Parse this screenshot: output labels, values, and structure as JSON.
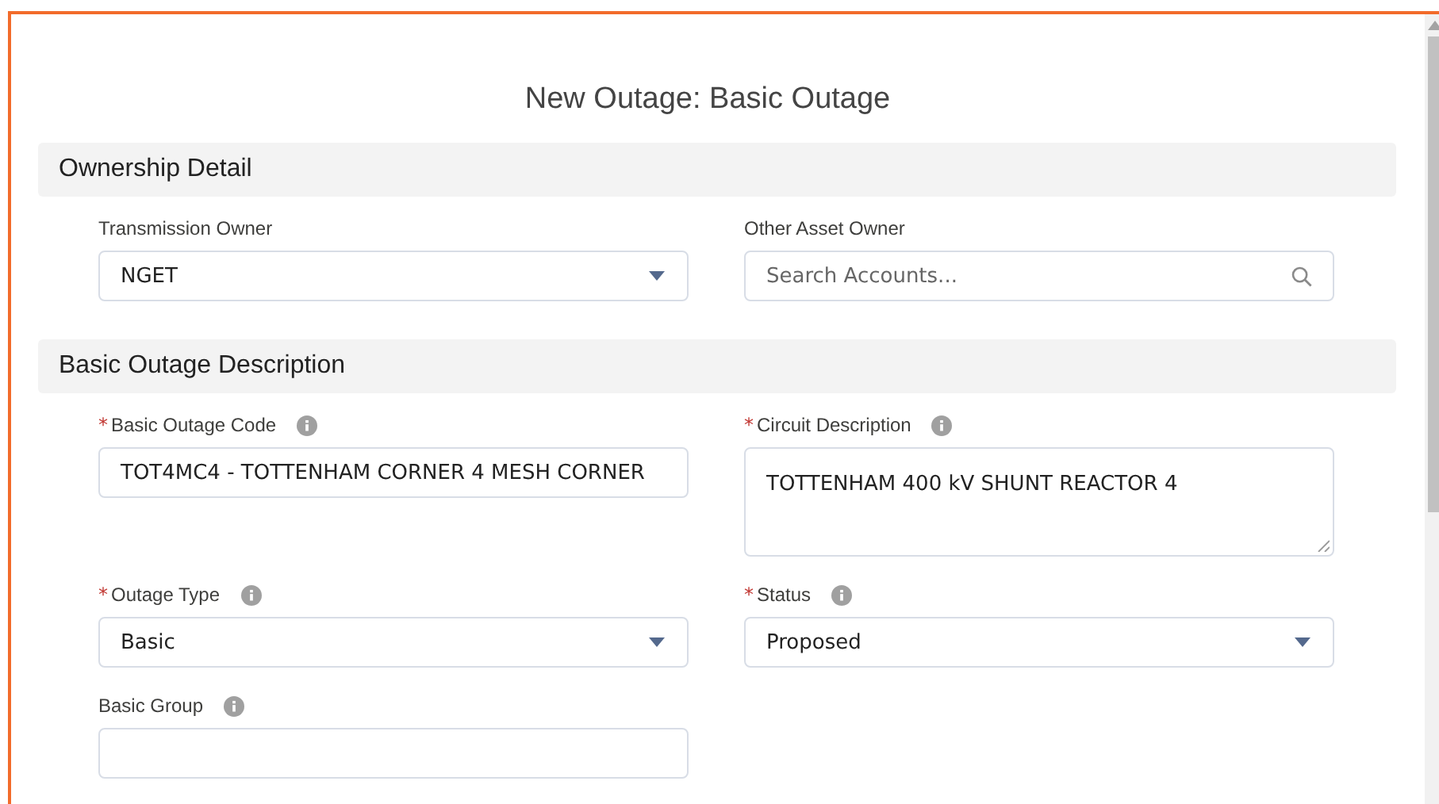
{
  "modal": {
    "title": "New Outage: Basic Outage"
  },
  "sections": [
    {
      "title": "Ownership Detail",
      "fields": [
        {
          "label": "Transmission Owner",
          "kind": "picklist",
          "value": "NGET"
        },
        {
          "label": "Other Asset Owner",
          "kind": "lookup",
          "placeholder": "Search Accounts..."
        }
      ]
    },
    {
      "title": "Basic Outage Description",
      "fields": [
        {
          "required_mark": "*",
          "label": "Basic Outage Code",
          "kind": "text",
          "info": true,
          "value": "TOT4MC4 - TOTTENHAM CORNER 4 MESH CORNER"
        },
        {
          "required_mark": "*",
          "label": "Circuit Description",
          "kind": "textarea",
          "info": true,
          "value": "TOTTENHAM 400 kV SHUNT REACTOR 4"
        },
        {
          "required_mark": "*",
          "label": "Outage Type",
          "kind": "picklist",
          "info": true,
          "value": "Basic"
        },
        {
          "required_mark": "*",
          "label": "Status",
          "kind": "picklist",
          "info": true,
          "value": "Proposed"
        },
        {
          "label": "Basic Group",
          "kind": "text",
          "info": true
        }
      ]
    }
  ]
}
